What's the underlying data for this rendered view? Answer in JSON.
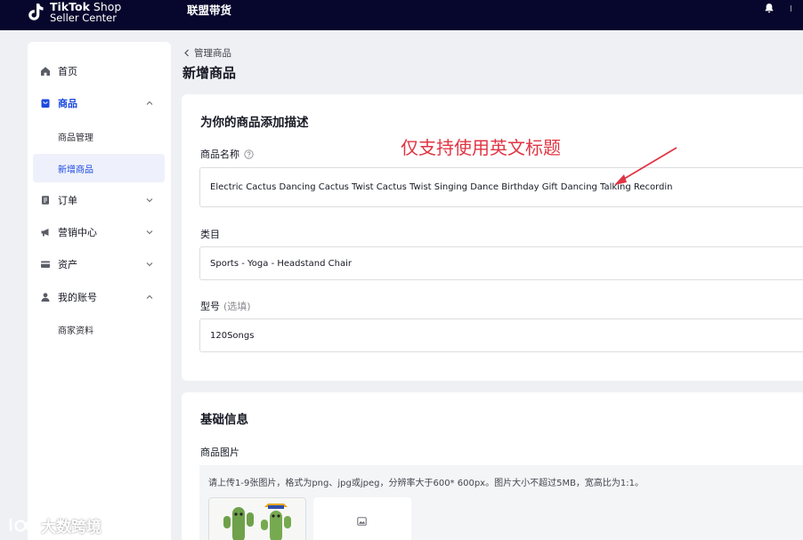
{
  "topbar": {
    "logo_line1_bold": "TikTok",
    "logo_line1_light": " Shop",
    "logo_line2": "Seller Center",
    "nav_label": "联盟带货"
  },
  "sidebar": {
    "items": [
      {
        "label": "首页",
        "icon": "home-icon"
      },
      {
        "label": "商品",
        "icon": "bag-icon",
        "expanded": true
      },
      {
        "label": "订单",
        "icon": "order-icon",
        "expanded": false
      },
      {
        "label": "营销中心",
        "icon": "megaphone-icon",
        "expanded": false
      },
      {
        "label": "资产",
        "icon": "card-icon",
        "expanded": false
      },
      {
        "label": "我的账号",
        "icon": "user-icon",
        "expanded": true
      }
    ],
    "product_sub": [
      "商品管理",
      "新增商品"
    ],
    "account_sub": [
      "商家资料"
    ]
  },
  "header": {
    "breadcrumb": "管理商品",
    "title": "新增商品"
  },
  "description_card": {
    "title": "为你的商品添加描述",
    "name_label": "商品名称",
    "name_value": "Electric Cactus Dancing Cactus Twist Cactus Twist Singing Dance Birthday Gift Dancing Talking Recordin",
    "category_label": "类目",
    "category_value": "Sports - Yoga - Headstand Chair",
    "model_label": "型号",
    "model_optional": "(选填)",
    "model_value": "120Songs"
  },
  "annotation": {
    "text": "仅支持使用英文标题",
    "color": "#e03543"
  },
  "basic_card": {
    "title": "基础信息",
    "images_label": "商品图片",
    "upload_hint": "请上传1-9张图片，格式为png、jpg或jpeg，分辨率大于600* 600px。图片大小不超过5MB，宽高比为1:1。"
  },
  "watermark": {
    "text": "大数跨境"
  },
  "colors": {
    "topbar": "#07062d",
    "accent": "#1c49e0",
    "annotation": "#e03543"
  }
}
